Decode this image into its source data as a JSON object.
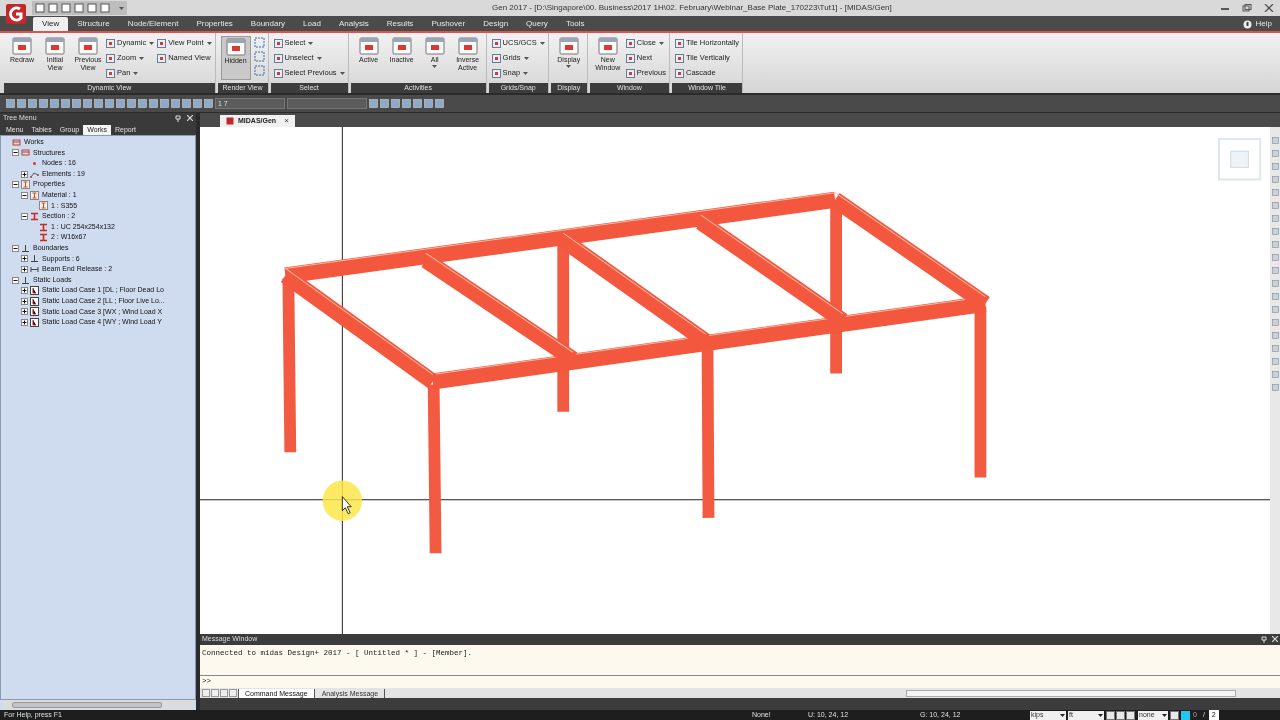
{
  "title_bar": {
    "title": "Gen 2017 - [D:\\Singapore\\00. Business\\2017 1H\\02. February\\Webinar_Base Plate_170223\\Tut1] - [MIDAS/Gen]"
  },
  "menu_tabs": [
    {
      "label": "View",
      "selected": true
    },
    {
      "label": "Structure",
      "selected": false
    },
    {
      "label": "Node/Element",
      "selected": false
    },
    {
      "label": "Properties",
      "selected": false
    },
    {
      "label": "Boundary",
      "selected": false
    },
    {
      "label": "Load",
      "selected": false
    },
    {
      "label": "Analysis",
      "selected": false
    },
    {
      "label": "Results",
      "selected": false
    },
    {
      "label": "Pushover",
      "selected": false
    },
    {
      "label": "Design",
      "selected": false
    },
    {
      "label": "Query",
      "selected": false
    },
    {
      "label": "Tools",
      "selected": false
    }
  ],
  "help": "Help",
  "ribbon_groups": [
    {
      "label": "Dynamic View",
      "columns": [
        [
          {
            "kind": "large",
            "label": "Redraw"
          }
        ],
        [
          {
            "kind": "large",
            "label": "Initial View"
          }
        ],
        [
          {
            "kind": "large",
            "label": "Previous View"
          }
        ],
        [
          {
            "kind": "small",
            "label": "Dynamic",
            "dropdown": true
          },
          {
            "kind": "small",
            "label": "Zoom",
            "dropdown": true
          },
          {
            "kind": "small",
            "label": "Pan",
            "dropdown": true
          }
        ],
        [
          {
            "kind": "small",
            "label": "View Point",
            "dropdown": true
          },
          {
            "kind": "small",
            "label": "Named View",
            "dropdown": false
          }
        ]
      ]
    },
    {
      "label": "Render View",
      "columns": [
        [
          {
            "kind": "large",
            "label": "Hidden",
            "pressed": true
          }
        ],
        [
          {
            "kind": "icon"
          },
          {
            "kind": "icon"
          },
          {
            "kind": "icon"
          }
        ]
      ]
    },
    {
      "label": "Select",
      "columns": [
        [
          {
            "kind": "small",
            "label": "Select",
            "dropdown": true
          },
          {
            "kind": "small",
            "label": "Unselect",
            "dropdown": true
          },
          {
            "kind": "small",
            "label": "Select Previous",
            "dropdown": true
          }
        ]
      ]
    },
    {
      "label": "Activities",
      "columns": [
        [
          {
            "kind": "large",
            "label": "Active"
          }
        ],
        [
          {
            "kind": "large",
            "label": "Inactive"
          }
        ],
        [
          {
            "kind": "large",
            "label": "All",
            "dropdown": true
          }
        ],
        [
          {
            "kind": "large",
            "label": "Inverse Active"
          }
        ]
      ]
    },
    {
      "label": "Grids/Snap",
      "columns": [
        [
          {
            "kind": "small",
            "label": "UCS/GCS",
            "dropdown": true
          },
          {
            "kind": "small",
            "label": "Grids",
            "dropdown": true
          },
          {
            "kind": "small",
            "label": "Snap",
            "dropdown": true
          }
        ]
      ]
    },
    {
      "label": "Display",
      "columns": [
        [
          {
            "kind": "large",
            "label": "Display",
            "dropdown": true
          }
        ]
      ]
    },
    {
      "label": "Window",
      "columns": [
        [
          {
            "kind": "large",
            "label": "New Window"
          }
        ],
        [
          {
            "kind": "small",
            "label": "Close",
            "dropdown": true
          },
          {
            "kind": "small",
            "label": "Next",
            "dropdown": false
          },
          {
            "kind": "small",
            "label": "Previous",
            "dropdown": false
          }
        ]
      ]
    },
    {
      "label": "Window Tile",
      "columns": [
        [
          {
            "kind": "small",
            "label": "Tile Horizontally",
            "dropdown": false
          },
          {
            "kind": "small",
            "label": "Tile Vertically",
            "dropdown": false
          },
          {
            "kind": "small",
            "label": "Cascade",
            "dropdown": false
          }
        ]
      ]
    }
  ],
  "toolbar": {
    "field_value": "1 7"
  },
  "tree_panel": {
    "title": "Tree Menu",
    "tabs": [
      {
        "label": "Menu",
        "selected": false
      },
      {
        "label": "Tables",
        "selected": false
      },
      {
        "label": "Group",
        "selected": false
      },
      {
        "label": "Works",
        "selected": true
      },
      {
        "label": "Report",
        "selected": false
      }
    ],
    "tree": [
      {
        "label": "Works",
        "kind": "structure",
        "children": [
          {
            "label": "Structures",
            "kind": "structure",
            "expanded": true,
            "children": [
              {
                "label": "Nodes : 16",
                "kind": "node"
              },
              {
                "label": "Elements : 19",
                "kind": "element",
                "expanded": false
              }
            ]
          },
          {
            "label": "Properties",
            "kind": "section",
            "expanded": true,
            "children": [
              {
                "label": "Material : 1",
                "kind": "section",
                "expanded": true,
                "children": [
                  {
                    "label": "1 : S355",
                    "kind": "section"
                  }
                ]
              },
              {
                "label": "Section : 2",
                "kind": "ibeam",
                "expanded": true,
                "children": [
                  {
                    "label": "1 : UC 254x254x132",
                    "kind": "ibeam"
                  },
                  {
                    "label": "2 : W16x67",
                    "kind": "ibeam"
                  }
                ]
              }
            ]
          },
          {
            "label": "Boundaries",
            "kind": "support",
            "expanded": true,
            "children": [
              {
                "label": "Supports : 6",
                "kind": "support",
                "expanded": false
              },
              {
                "label": "Beam End Release : 2",
                "kind": "release",
                "expanded": false
              }
            ]
          },
          {
            "label": "Static Loads",
            "kind": "support",
            "expanded": true,
            "children": [
              {
                "label": "Static Load Case 1 [DL ; Floor Dead Lo",
                "kind": "load",
                "expanded": false
              },
              {
                "label": "Static Load Case 2 [LL ; Floor Live Lo...",
                "kind": "load",
                "expanded": false
              },
              {
                "label": "Static Load Case 3 [WX ; Wind Load X",
                "kind": "load",
                "expanded": false
              },
              {
                "label": "Static Load Case 4 [WY ; Wind Load Y",
                "kind": "load",
                "expanded": false
              }
            ]
          }
        ]
      }
    ]
  },
  "viewport": {
    "tab": "MIDAS/Gen",
    "close": "×"
  },
  "message_window": {
    "title": "Message Window",
    "lines": [
      "Connected to midas Design+ 2017 - [ Untitled * ] - [Member]."
    ],
    "prompt": ">>",
    "tabs": [
      {
        "label": "Command Message",
        "selected": true
      },
      {
        "label": "Analysis Message",
        "selected": false
      }
    ]
  },
  "status_bar": {
    "help": "For Help, press F1",
    "snap": "None!",
    "ucs": "U: 10, 24, 12",
    "gcs": "G: 10, 24, 12",
    "force_unit": "kips",
    "length_unit": "ft",
    "mode": "none",
    "page": "0",
    "separator": "/",
    "total": "2"
  }
}
